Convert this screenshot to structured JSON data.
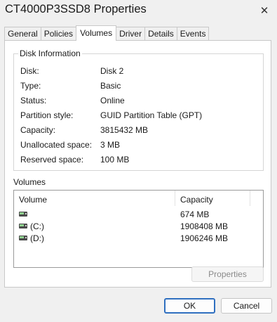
{
  "window": {
    "title": "CT4000P3SSD8 Properties",
    "close_glyph": "✕"
  },
  "tabs": [
    {
      "label": "General"
    },
    {
      "label": "Policies"
    },
    {
      "label": "Volumes",
      "active": true
    },
    {
      "label": "Driver"
    },
    {
      "label": "Details"
    },
    {
      "label": "Events"
    }
  ],
  "disk_info": {
    "legend": "Disk Information",
    "rows": [
      {
        "label": "Disk:",
        "value": "Disk 2"
      },
      {
        "label": "Type:",
        "value": "Basic"
      },
      {
        "label": "Status:",
        "value": "Online"
      },
      {
        "label": "Partition style:",
        "value": "GUID Partition Table (GPT)"
      },
      {
        "label": "Capacity:",
        "value": "3815432 MB"
      },
      {
        "label": "Unallocated space:",
        "value": "3 MB"
      },
      {
        "label": "Reserved space:",
        "value": "100 MB"
      }
    ]
  },
  "volumes": {
    "label": "Volumes",
    "columns": [
      "Volume",
      "Capacity"
    ],
    "rows": [
      {
        "name": "",
        "capacity": "674 MB",
        "icon": "drive-icon"
      },
      {
        "name": "(C:)",
        "capacity": "1908408 MB",
        "icon": "drive-icon"
      },
      {
        "name": "(D:)",
        "capacity": "1906246 MB",
        "icon": "drive-icon"
      }
    ],
    "properties_button": "Properties"
  },
  "footer": {
    "ok_label": "OK",
    "cancel_label": "Cancel"
  },
  "colors": {
    "accent": "#2f6fc0",
    "background": "#f0f0f0"
  }
}
